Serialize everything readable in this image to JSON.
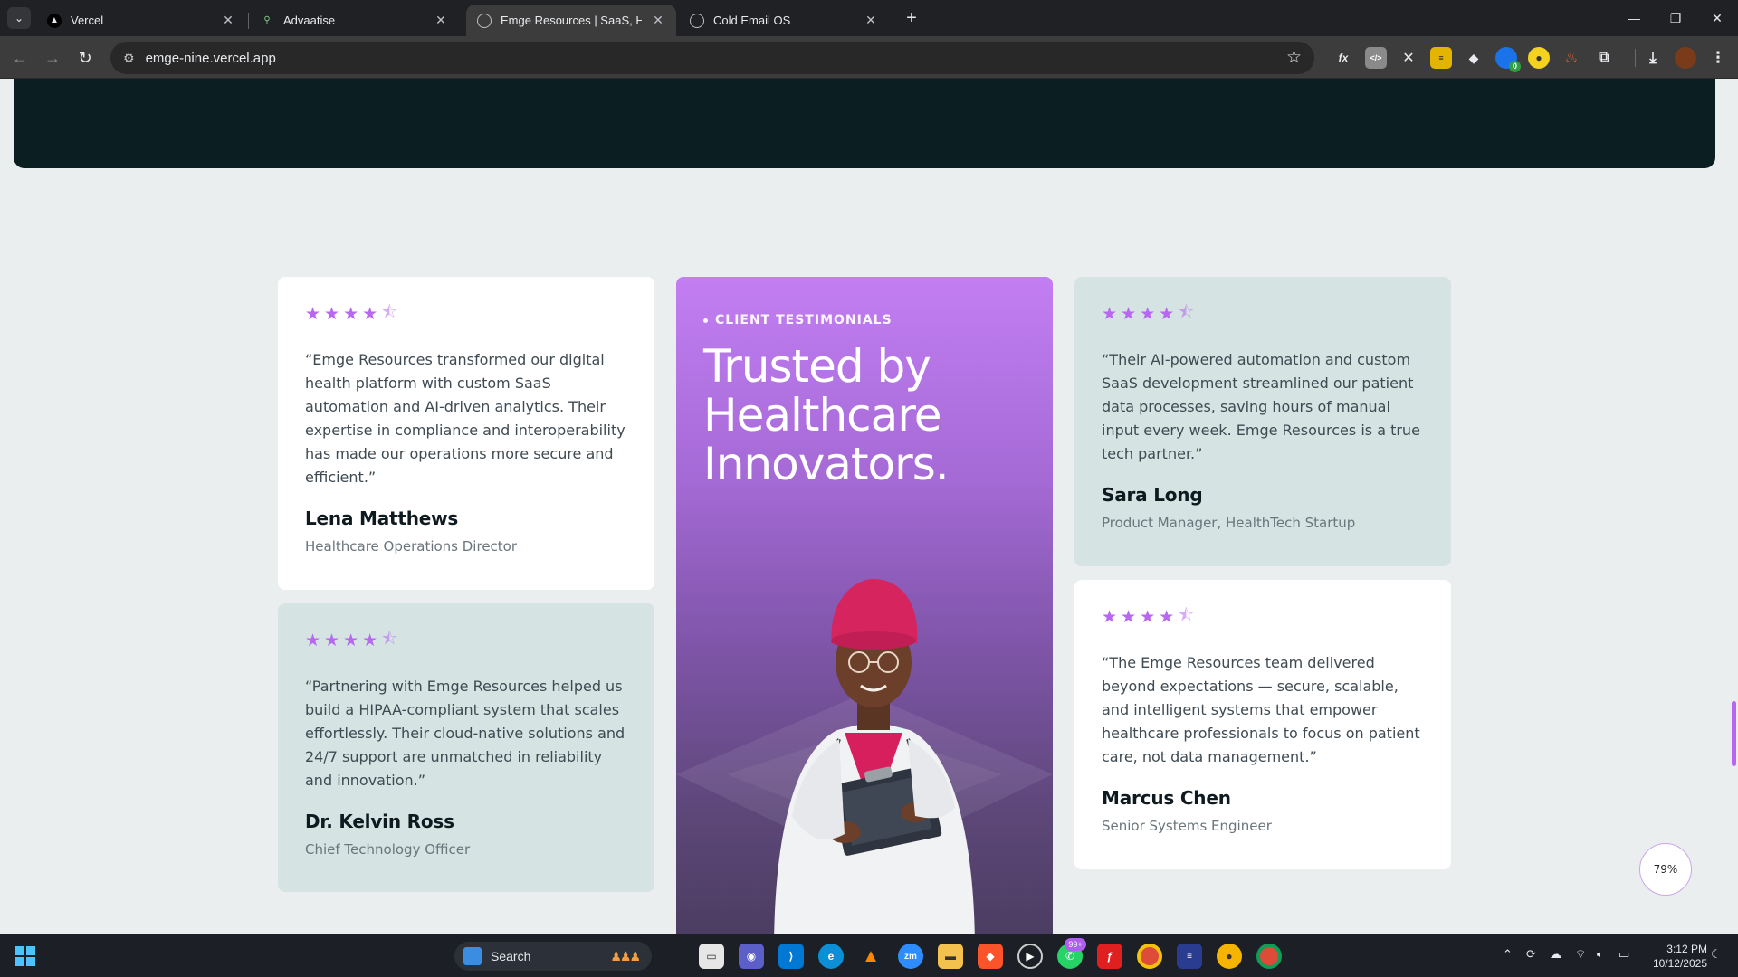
{
  "browser": {
    "tabs": [
      {
        "title": "Vercel",
        "favicon": "vercel-icon"
      },
      {
        "title": "Advaatise",
        "favicon": "advaatise-icon"
      },
      {
        "title": "Emge Resources | SaaS, Health-",
        "favicon": "globe-icon",
        "active": true
      },
      {
        "title": "Cold Email OS",
        "favicon": "globe-icon"
      }
    ],
    "url": "emge-nine.vercel.app",
    "extensions": [
      "fx-icon",
      "code-icon",
      "x-icon",
      "tag-icon",
      "stack-icon",
      "badge-icon",
      "circle-icon",
      "flame-icon",
      "puzzle-icon"
    ],
    "extension_badge": "0"
  },
  "testimonials": {
    "eyebrow": "CLIENT TESTIMONIALS",
    "title": "Trusted by Healthcare Innovators.",
    "rating": 4.5,
    "cards": [
      {
        "quote": "“Emge Resources transformed our digital health platform with custom SaaS automation and AI-driven analytics. Their expertise in compliance and interoperability has made our operations more secure and efficient.”",
        "name": "Lena Matthews",
        "role": "Healthcare Operations Director"
      },
      {
        "quote": "“Partnering with Emge Resources helped us build a HIPAA-compliant system that scales effortlessly. Their cloud-native solutions and 24/7 support are unmatched in reliability and innovation.”",
        "name": "Dr. Kelvin Ross",
        "role": "Chief Technology Officer"
      },
      {
        "quote": "“Their AI-powered automation and custom SaaS development streamlined our patient data processes, saving hours of manual input every week. Emge Resources is a true tech partner.”",
        "name": "Sara Long",
        "role": "Product Manager, HealthTech Startup"
      },
      {
        "quote": "“The Emge Resources team delivered beyond expectations — secure, scalable, and intelligent systems that empower healthcare professionals to focus on patient care, not data management.”",
        "name": "Marcus Chen",
        "role": "Senior Systems Engineer"
      }
    ]
  },
  "scroll_progress": "79%",
  "taskbar": {
    "search_label": "Search",
    "notification_badge": "99+",
    "time": "3:12 PM",
    "date": "10/12/2025"
  },
  "colors": {
    "accent": "#b867f0",
    "banner": "#0b1e22",
    "page_bg": "#eaeeee",
    "mint_card": "#d5e3e2"
  }
}
